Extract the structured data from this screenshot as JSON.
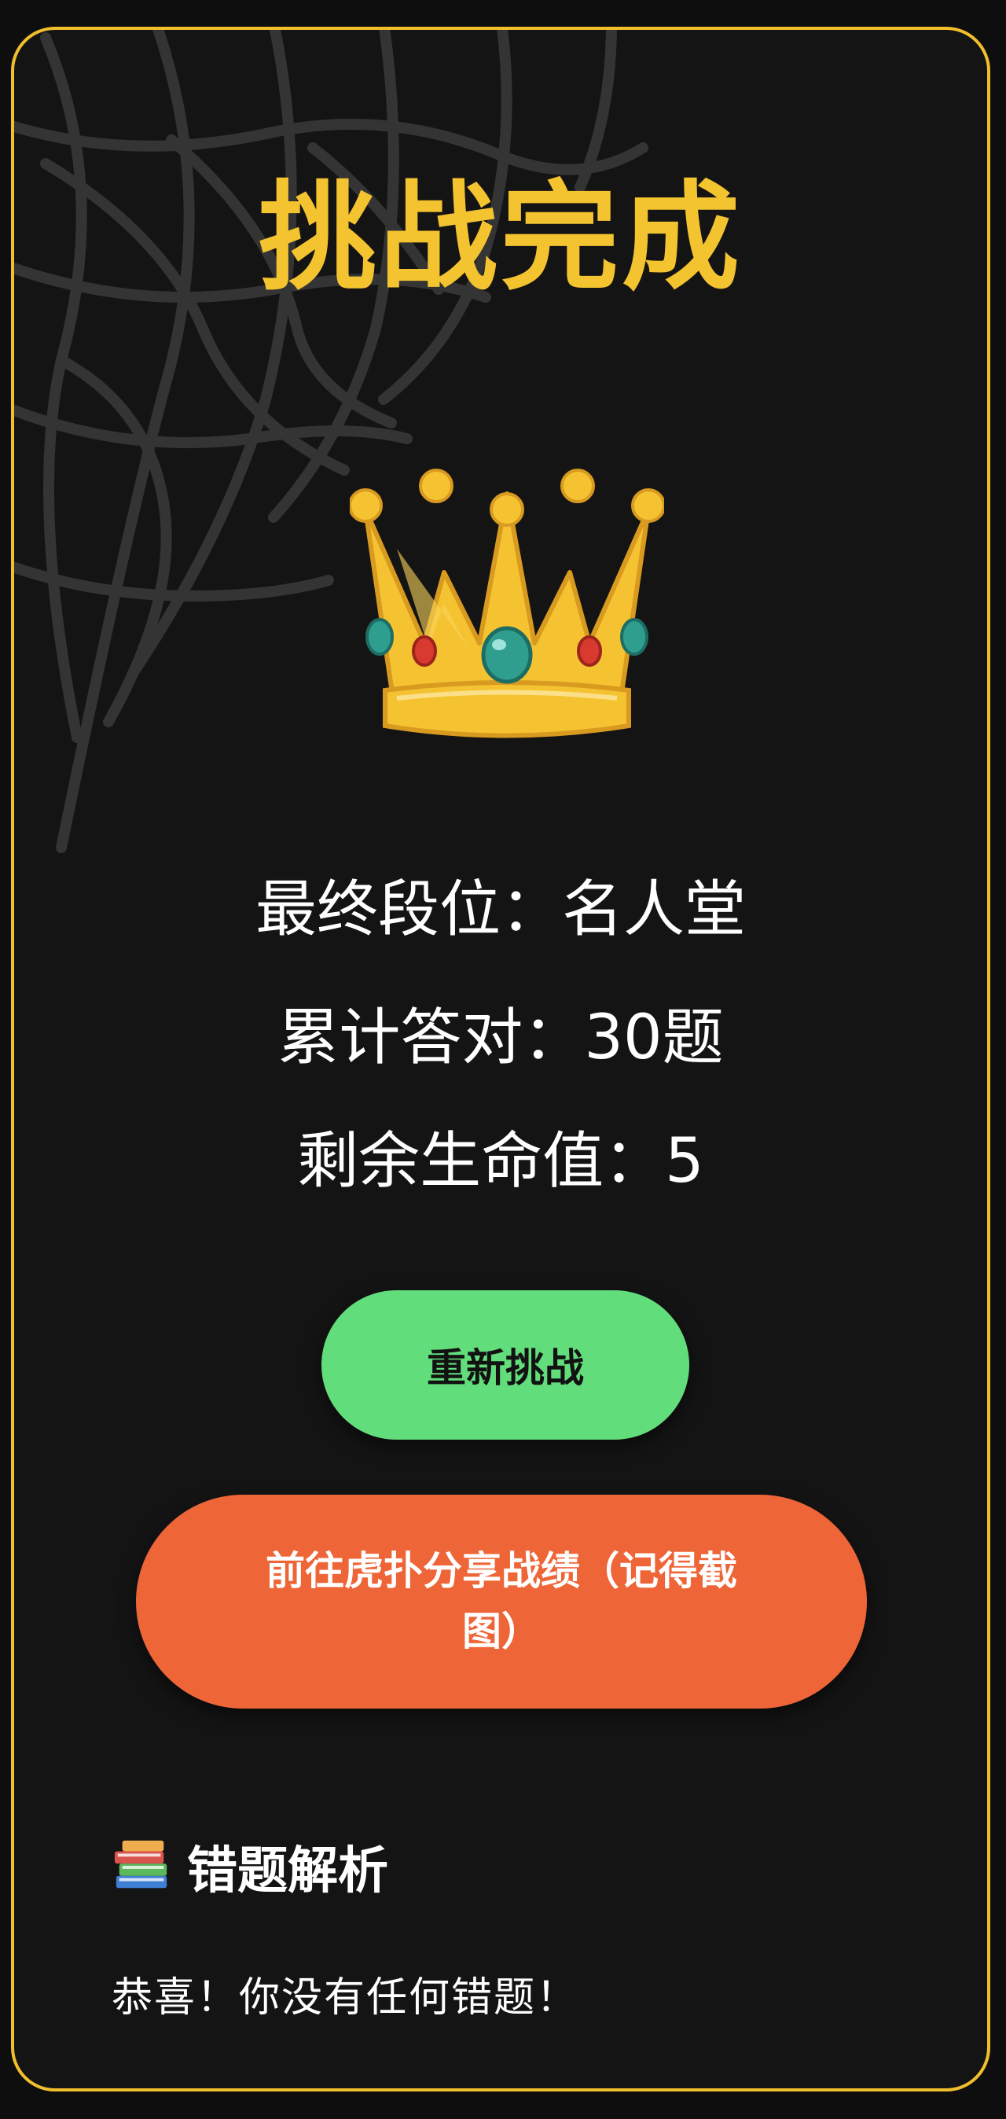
{
  "result": {
    "title": "挑战完成",
    "crown_icon": "crown-icon",
    "stats": {
      "rank": "最终段位：名人堂",
      "correct": "累计答对：30题",
      "lives": "剩余生命值：5"
    }
  },
  "actions": {
    "retry_label": "重新挑战",
    "share_label": "前往虎扑分享战绩（记得截图）"
  },
  "review": {
    "icon": "books-icon",
    "title": "错题解析",
    "message": "恭喜！你没有任何错题！"
  },
  "colors": {
    "accent_gold": "#f4c330",
    "retry_green": "#62dd7b",
    "share_orange": "#ee6538",
    "background": "#141414"
  }
}
